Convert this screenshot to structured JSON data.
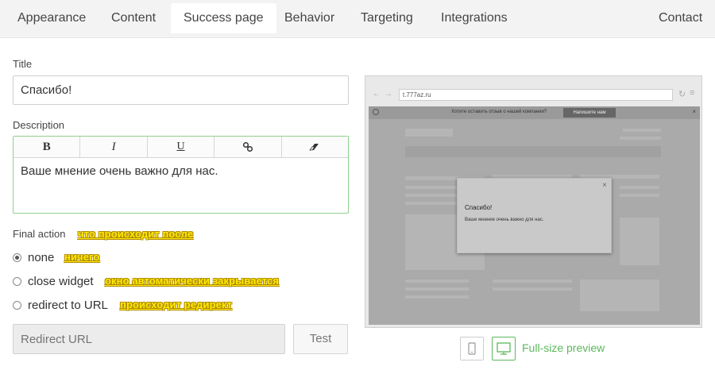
{
  "nav": {
    "tabs": [
      "Appearance",
      "Content",
      "Success page",
      "Behavior",
      "Targeting",
      "Integrations"
    ],
    "active": "Success page",
    "contact": "Contact"
  },
  "form": {
    "title_label": "Title",
    "title_value": "Спасибо!",
    "description_label": "Description",
    "toolbar": {
      "bold": "B",
      "italic": "I",
      "underline": "U"
    },
    "description_value": "Ваше мнение очень важно для нас.",
    "final_action_label": "Final action",
    "final_action_hint": "что происходит после",
    "options": [
      {
        "label": "none",
        "hint": "ничего",
        "checked": true
      },
      {
        "label": "close widget",
        "hint": "окно автоматически закрывается",
        "checked": false
      },
      {
        "label": "redirect to URL",
        "hint": "происходит редирект",
        "checked": false
      }
    ],
    "redirect_placeholder": "Redirect URL",
    "test_label": "Test"
  },
  "preview": {
    "url": "t.777az.ru",
    "site_bar_text": "Хотите оставить отзыв о нашей компании?",
    "site_bar_button": "Напишите нам",
    "modal_title": "Спасибо!",
    "modal_text": "Ваше мнение очень важно для нас.",
    "full_size_label": "Full-size preview"
  },
  "colors": {
    "accent": "#5cb85c",
    "hint_yellow": "#ffeb00"
  }
}
